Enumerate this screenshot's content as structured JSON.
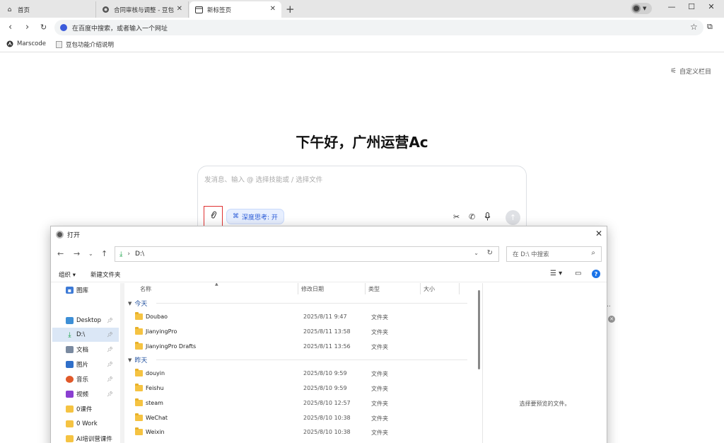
{
  "tabs": [
    {
      "label": "首页",
      "icon": "home-icon",
      "active": false
    },
    {
      "label": "合同审核与调整 - 豆包",
      "icon": "doubao-icon",
      "active": false
    },
    {
      "label": "新标签页",
      "icon": "tab-page-icon",
      "active": true
    }
  ],
  "window": {
    "minimize": "—",
    "maximize": "☐",
    "close": "✕"
  },
  "address_bar": {
    "placeholder": "在百度中搜索，或者输入一个网址",
    "engine_icon": "baidu-icon"
  },
  "bookmarks": [
    {
      "label": "Marscode",
      "icon": "marscode-icon"
    },
    {
      "label": "豆包功能介绍说明",
      "icon": "document-icon"
    }
  ],
  "page": {
    "customize_label": "自定义栏目",
    "greeting": "下午好，广州运营Ac",
    "chat_placeholder": "发消息、输入 @ 选择技能或 / 选择文件",
    "deep_think_label": "深度思考: 开"
  },
  "dialog": {
    "title": "打开",
    "path": "D:\\",
    "search_placeholder": "在 D:\\ 中搜索",
    "organize_label": "组织 ▾",
    "new_folder_label": "新建文件夹",
    "nav_items": [
      {
        "label": "图库",
        "icon": "gallery-icon",
        "pinned": false,
        "selected": false
      },
      {
        "label": "Desktop",
        "icon": "desktop-icon",
        "pinned": true,
        "selected": false
      },
      {
        "label": "D:\\",
        "icon": "download-icon",
        "pinned": true,
        "selected": true
      },
      {
        "label": "文档",
        "icon": "documents-icon",
        "pinned": true,
        "selected": false
      },
      {
        "label": "图片",
        "icon": "pictures-icon",
        "pinned": true,
        "selected": false
      },
      {
        "label": "音乐",
        "icon": "music-icon",
        "pinned": true,
        "selected": false
      },
      {
        "label": "视频",
        "icon": "videos-icon",
        "pinned": true,
        "selected": false
      },
      {
        "label": "0课件",
        "icon": "folder-icon",
        "pinned": false,
        "selected": false
      },
      {
        "label": "0 Work",
        "icon": "folder-icon",
        "pinned": false,
        "selected": false
      },
      {
        "label": "AI培训营课件",
        "icon": "folder-icon",
        "pinned": false,
        "selected": false
      }
    ],
    "columns": {
      "name": "名称",
      "modified": "修改日期",
      "type": "类型",
      "size": "大小"
    },
    "groups": [
      {
        "label": "今天",
        "files": [
          {
            "name": "Doubao",
            "modified": "2025/8/11 9:47",
            "type": "文件夹"
          },
          {
            "name": "JianyingPro",
            "modified": "2025/8/11 13:58",
            "type": "文件夹"
          },
          {
            "name": "JianyingPro Drafts",
            "modified": "2025/8/11 13:56",
            "type": "文件夹"
          }
        ]
      },
      {
        "label": "昨天",
        "files": [
          {
            "name": "douyin",
            "modified": "2025/8/10 9:59",
            "type": "文件夹"
          },
          {
            "name": "Feishu",
            "modified": "2025/8/10 9:59",
            "type": "文件夹"
          },
          {
            "name": "steam",
            "modified": "2025/8/10 12:57",
            "type": "文件夹"
          },
          {
            "name": "WeChat",
            "modified": "2025/8/10 10:38",
            "type": "文件夹"
          },
          {
            "name": "Weixin",
            "modified": "2025/8/10 10:38",
            "type": "文件夹"
          }
        ]
      }
    ],
    "preview_text": "选择要预览的文件。"
  }
}
